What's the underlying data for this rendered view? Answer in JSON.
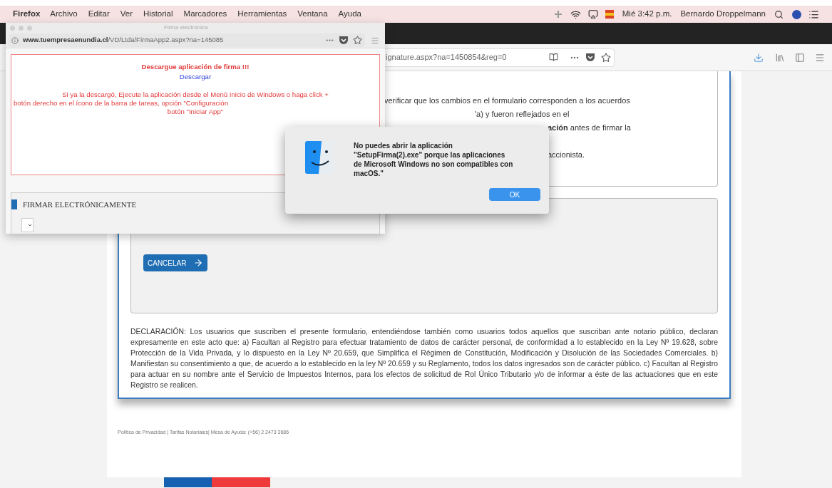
{
  "menu_bar": {
    "app": "Firefox",
    "items": [
      "Archivo",
      "Editar",
      "Ver",
      "Historial",
      "Marcadores",
      "Herramientas",
      "Ventana",
      "Ayuda"
    ],
    "clock": "Mié 3:42 p.m.",
    "user": "Bernardo Droppelmann"
  },
  "main_window": {
    "url": "ignature.aspx?na=1450854&reg=0",
    "notice_lines": [
      "verificar que los cambios en el formulario corresponden a los acuerdos",
      "'a) y fueron reflejados en el",
      "**ación** antes de firmar la",
      "accionista."
    ],
    "cancel_button": "CANCELAR",
    "declaration": "DECLARACIÓN: Los usuarios que suscriben el presente formulario, entendiéndose también como usuarios todos aquellos que suscriban ante notario público, declaran expresamente en este acto que: a) Facultan al Registro para efectuar tratamiento de datos de carácter personal, de conformidad a lo establecido en la Ley Nº 19.628, sobre Protección de la Vida Privada, y lo dispuesto en la Ley Nº 20.659, que Simplifica el Régimen de Constitución, Modificación y Disolución de las Sociedades Comerciales. b) Manifiestan su consentimiento a que, de acuerdo a lo establecido en la ley Nº 20.659 y su Reglamento, todos los datos ingresados son de carácter público. c) Facultan al Registro para actuar en su nombre ante el Servicio de Impuestos Internos, para los efectos de solicitud de Rol Único Tributario y/o de informar a éste de las actuaciones que en este Registro se realicen.",
    "footer": "Política de Privacidad | Tarifas Notariales| Mesa de Ayuda: (+56) 2 2473 3686"
  },
  "popup_window": {
    "title": "Firma electrónica",
    "url_host": "www.tuempresaenundia.cl",
    "url_path": "/VD/Ltda/FirmaApp2.aspx?na=145085",
    "download_title": "Descargue aplicación de firma !!!",
    "download_link": "Descargar",
    "instructions": [
      "Si ya la descargó, Ejecute la aplicación desde el Menú Inicio de Windows o haga click +",
      "botón derecho en el ícono de la barra de tareas, opción \"Configuración",
      "botón \"Iniciar App\""
    ],
    "sign_title": "FIRMAR ELECTRÓNICAMENTE"
  },
  "alert": {
    "message": "No puedes abrir la aplicación \"SetupFirma(2).exe\" porque las aplicaciones de Microsoft Windows no son compatibles con macOS.\"",
    "ok_button": "OK"
  }
}
